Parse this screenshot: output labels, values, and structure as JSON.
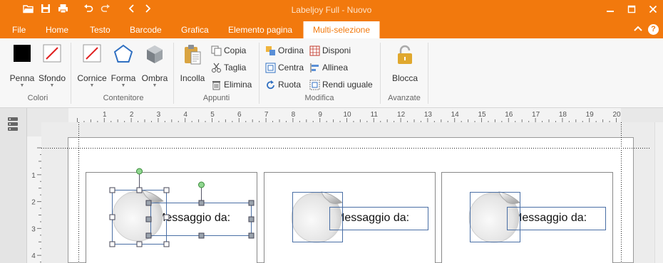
{
  "window": {
    "title": "Labeljoy Full - Nuovo"
  },
  "tabs": [
    "File",
    "Home",
    "Testo",
    "Barcode",
    "Grafica",
    "Elemento pagina",
    "Multi-selezione"
  ],
  "active_tab": "Multi-selezione",
  "ribbon": {
    "colori": {
      "label": "Colori",
      "penna": "Penna",
      "sfondo": "Sfondo"
    },
    "contenitore": {
      "label": "Contenitore",
      "cornice": "Cornice",
      "forma": "Forma",
      "ombra": "Ombra"
    },
    "appunti": {
      "label": "Appunti",
      "incolla": "Incolla",
      "copia": "Copia",
      "taglia": "Taglia",
      "elimina": "Elimina"
    },
    "modifica": {
      "label": "Modifica",
      "ordina": "Ordina",
      "centra": "Centra",
      "ruota": "Ruota",
      "disponi": "Disponi",
      "allinea": "Allinea",
      "rendi_uguale": "Rendi uguale"
    },
    "avanzate": {
      "label": "Avanzate",
      "blocca": "Blocca"
    }
  },
  "ruler": {
    "h_ticks": [
      "1",
      "2",
      "3",
      "4",
      "5",
      "6",
      "7",
      "8",
      "9",
      "10",
      "11",
      "12",
      "13",
      "14",
      "15",
      "16",
      "17",
      "18",
      "19",
      "20"
    ],
    "v_ticks": [
      "1",
      "2",
      "3",
      "4"
    ]
  },
  "labels": [
    {
      "text": "Messaggio da:"
    },
    {
      "text": "Messaggio da:"
    },
    {
      "text": "Messaggio da:"
    }
  ],
  "colors": {
    "accent": "#f2790d",
    "selection": "#4a6fa5"
  }
}
